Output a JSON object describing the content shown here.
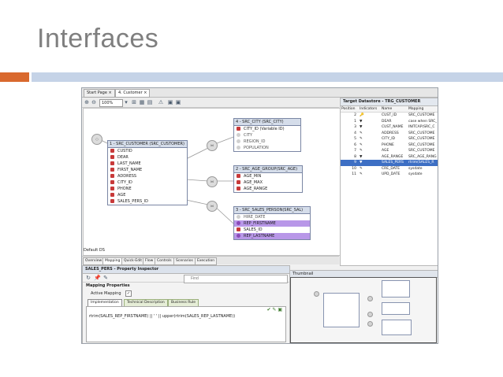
{
  "slide": {
    "title": "Interfaces"
  },
  "colors": {
    "accent_orange": "#d9692e",
    "accent_blue": "#c5d3e7",
    "selection": "#b897e8",
    "row_selected": "#3d6fc4"
  },
  "editor_tabs": [
    "Start Page",
    "4. Customer"
  ],
  "toolbar": {
    "zoom": "100%"
  },
  "models": {
    "customer": {
      "title": "1 - SRC_CUSTOMER (SRC_CUSTOMER)",
      "attrs": [
        "CUSTID",
        "DEAR",
        "LAST_NAME",
        "FIRST_NAME",
        "ADDRESS",
        "CITY_ID",
        "PHONE",
        "AGE",
        "SALES_PERS_ID"
      ]
    },
    "city": {
      "title": "4 - SRC_CITY (SRC_CITY)",
      "attrs": [
        "CITY_ID (Variable ID)",
        "CITY",
        "REGION_ID",
        "POPULATION"
      ]
    },
    "age": {
      "title": "2 - SRC_AGE_GROUP(SRC_AGE)",
      "attrs": [
        "AGE_MIN",
        "AGE_MAX",
        "AGE_RANGE"
      ]
    },
    "sales": {
      "title": "3 - SRC_SALES_PERSON(SRC_SAL)",
      "attrs": [
        "HIRE_DATE",
        "REP_FIRSTNAME",
        "SALES_ID",
        "REP_LASTNAME"
      ]
    }
  },
  "default_ds": "Default DS",
  "bottom_tabs": [
    "Overview",
    "Mapping",
    "Quick-Edit",
    "Flow",
    "Controls",
    "Scenarios",
    "Execution"
  ],
  "target": {
    "title": "Target Datastore - TRG_CUSTOMER",
    "columns": [
      "Position",
      "Indicators",
      "Name",
      "Mapping"
    ],
    "rows": [
      {
        "pos": "2",
        "name": "CUST_ID",
        "map": "SRC_CUSTOME"
      },
      {
        "pos": "1",
        "name": "DEAR",
        "map": "case when SRC_"
      },
      {
        "pos": "3",
        "name": "CUST_NAME",
        "map": "INITCAP(SRC_C"
      },
      {
        "pos": "4",
        "name": "ADDRESS",
        "map": "SRC_CUSTOME"
      },
      {
        "pos": "5",
        "name": "CITY_ID",
        "map": "SRC_CUSTOME"
      },
      {
        "pos": "6",
        "name": "PHONE",
        "map": "SRC_CUSTOME"
      },
      {
        "pos": "7",
        "name": "AGE",
        "map": "SRC_CUSTOME"
      },
      {
        "pos": "8",
        "name": "AGE_RANGE",
        "map": "SRC_AGE_RANG"
      },
      {
        "pos": "9",
        "name": "SALES_PERS",
        "map": "rtrim(SALES_R"
      },
      {
        "pos": "10",
        "name": "CRE_DATE",
        "map": "sysdate"
      },
      {
        "pos": "11",
        "name": "UPD_DATE",
        "map": "sysdate"
      }
    ]
  },
  "inspector": {
    "title": "SALES_PERS - Property Inspector",
    "find_placeholder": "Find",
    "section": "Mapping Properties",
    "active_label": "Active Mapping",
    "tabs": [
      "Implementation",
      "Technical Description",
      "Business Rule"
    ],
    "expression": "rtrim(SALES_REP_FIRSTNAME) || ' ' || upper(rtrim(SALES_REP_LASTNAME))"
  },
  "thumbnail": {
    "title": "Thumbnail"
  }
}
